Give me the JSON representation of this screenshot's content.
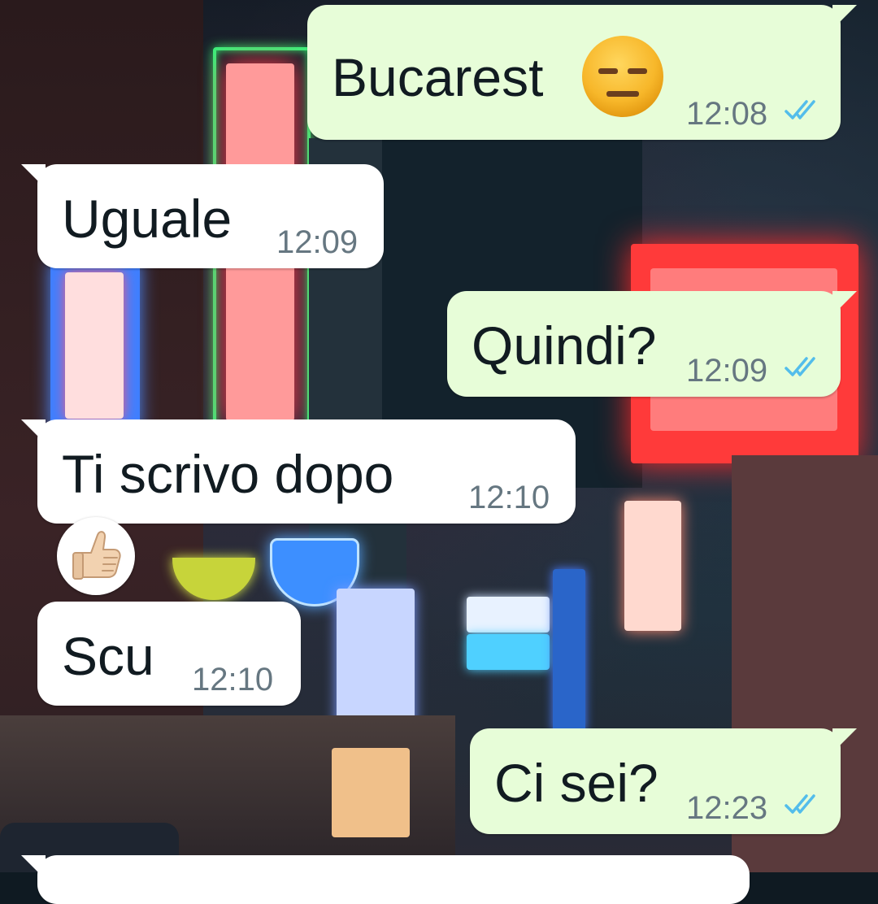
{
  "messages": [
    {
      "direction": "outgoing",
      "text": "Bucarest",
      "emoji": "expressionless-face",
      "time": "12:08",
      "status": "read"
    },
    {
      "direction": "incoming",
      "text": "Uguale",
      "time": "12:09"
    },
    {
      "direction": "outgoing",
      "text": "Quindi?",
      "time": "12:09",
      "status": "read"
    },
    {
      "direction": "incoming",
      "text": "Ti scrivo dopo",
      "time": "12:10",
      "reaction": "thumbs-up-light-skin"
    },
    {
      "direction": "incoming",
      "text": "Scu",
      "time": "12:10"
    },
    {
      "direction": "outgoing",
      "text": "Ci sei?",
      "time": "12:23",
      "status": "read"
    }
  ],
  "colors": {
    "outgoing_bubble": "#e7fdd8",
    "incoming_bubble": "#ffffff",
    "read_ticks": "#53bdeb",
    "timestamp": "#667781"
  }
}
